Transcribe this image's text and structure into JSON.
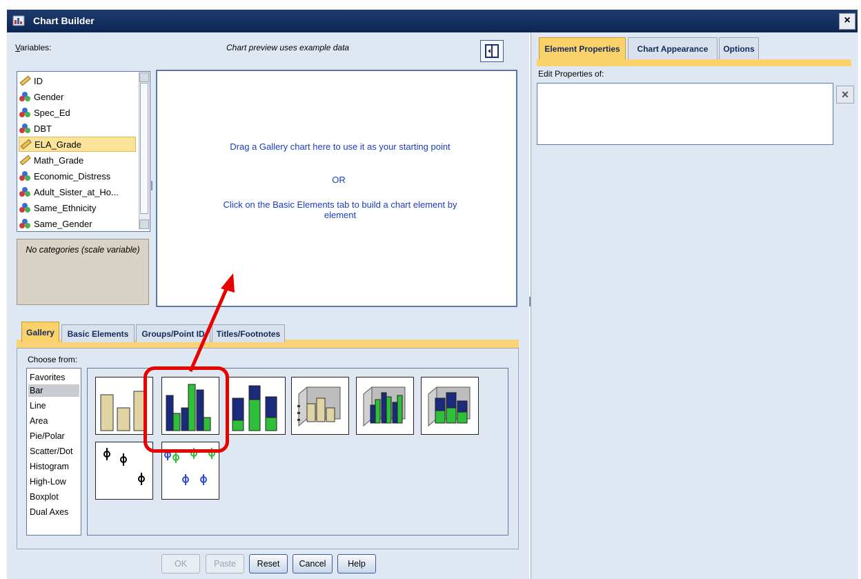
{
  "window": {
    "title": "Chart Builder",
    "close": "×"
  },
  "variables": {
    "label": "Variables:",
    "items": [
      {
        "name": "ID",
        "type": "scale"
      },
      {
        "name": "Gender",
        "type": "nominal"
      },
      {
        "name": "Spec_Ed",
        "type": "nominal"
      },
      {
        "name": "DBT",
        "type": "nominal"
      },
      {
        "name": "ELA_Grade",
        "type": "scale",
        "selected": true
      },
      {
        "name": "Math_Grade",
        "type": "scale"
      },
      {
        "name": "Economic_Distress",
        "type": "nominal"
      },
      {
        "name": "Adult_Sister_at_Ho...",
        "type": "nominal"
      },
      {
        "name": "Same_Ethnicity",
        "type": "nominal"
      },
      {
        "name": "Same_Gender",
        "type": "nominal"
      }
    ],
    "categories_note": "No categories (scale variable)"
  },
  "preview": {
    "header": "Chart preview uses example data",
    "line1": "Drag a Gallery chart here to use it as your starting point",
    "line2": "OR",
    "line3": "Click on the Basic Elements tab to build a chart element by element"
  },
  "bottom_tabs": [
    "Gallery",
    "Basic Elements",
    "Groups/Point ID",
    "Titles/Footnotes"
  ],
  "gallery": {
    "choose_label": "Choose from:",
    "types": [
      "Favorites",
      "Bar",
      "Line",
      "Area",
      "Pie/Polar",
      "Scatter/Dot",
      "Histogram",
      "High-Low",
      "Boxplot",
      "Dual Axes"
    ],
    "selected_type": "Bar"
  },
  "buttons": {
    "ok": "OK",
    "paste": "Paste",
    "reset": "Reset",
    "cancel": "Cancel",
    "help": "Help"
  },
  "right": {
    "tabs": [
      "Element Properties",
      "Chart Appearance",
      "Options"
    ],
    "edit_label": "Edit Properties of:",
    "delete_icon": "×"
  },
  "colors": {
    "navy": "#1b2a7a",
    "green": "#2fbf3a",
    "tan": "#e0d4a4",
    "highlight": "#e60000",
    "tab_active": "#fbd26a"
  }
}
